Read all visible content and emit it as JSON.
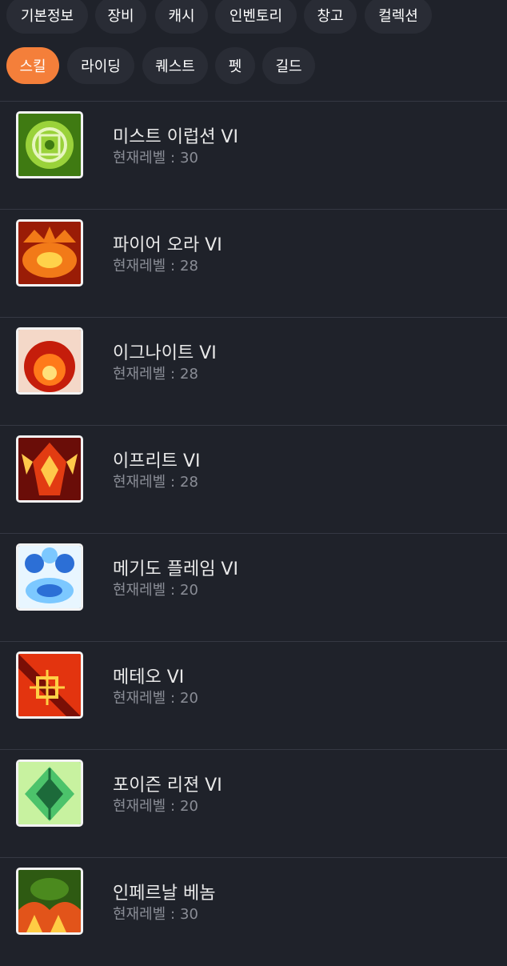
{
  "tabs_row1": [
    {
      "label": "기본정보",
      "active": false
    },
    {
      "label": "장비",
      "active": false
    },
    {
      "label": "캐시",
      "active": false
    },
    {
      "label": "인벤토리",
      "active": false
    },
    {
      "label": "창고",
      "active": false
    },
    {
      "label": "컬렉션",
      "active": false
    }
  ],
  "tabs_row2": [
    {
      "label": "스킬",
      "active": true
    },
    {
      "label": "라이딩",
      "active": false
    },
    {
      "label": "퀘스트",
      "active": false
    },
    {
      "label": "펫",
      "active": false
    },
    {
      "label": "길드",
      "active": false
    }
  ],
  "level_label": "현재레벨 :",
  "skills": [
    {
      "name": "미스트 이럽션 VI",
      "level": "30",
      "icon": "mist-eruption-icon",
      "colors": [
        "#3f7a12",
        "#9ad23a",
        "#e7f6c0"
      ]
    },
    {
      "name": "파이어 오라 VI",
      "level": "28",
      "icon": "fire-aura-icon",
      "colors": [
        "#9a1c06",
        "#f27a18",
        "#ffd24a"
      ]
    },
    {
      "name": "이그나이트 VI",
      "level": "28",
      "icon": "ignite-icon",
      "colors": [
        "#c51d0b",
        "#ff7a1a",
        "#ffe07a"
      ]
    },
    {
      "name": "이프리트 VI",
      "level": "28",
      "icon": "ifrit-icon",
      "colors": [
        "#6a0d08",
        "#e23c12",
        "#ffc94a"
      ]
    },
    {
      "name": "메기도 플레임 VI",
      "level": "20",
      "icon": "megido-flame-icon",
      "colors": [
        "#2c6fd6",
        "#7cc8ff",
        "#e8f6ff"
      ]
    },
    {
      "name": "메테오 VI",
      "level": "20",
      "icon": "meteor-icon",
      "colors": [
        "#7a0f06",
        "#e3340f",
        "#ffd045"
      ]
    },
    {
      "name": "포이즌 리젼 VI",
      "level": "20",
      "icon": "poison-region-icon",
      "colors": [
        "#1c6a3a",
        "#4cc36b",
        "#c8f2a0"
      ]
    },
    {
      "name": "인페르날 베놈",
      "level": "30",
      "icon": "infernal-venom-icon",
      "colors": [
        "#2e5a12",
        "#e2541a",
        "#ffcc44"
      ]
    }
  ]
}
